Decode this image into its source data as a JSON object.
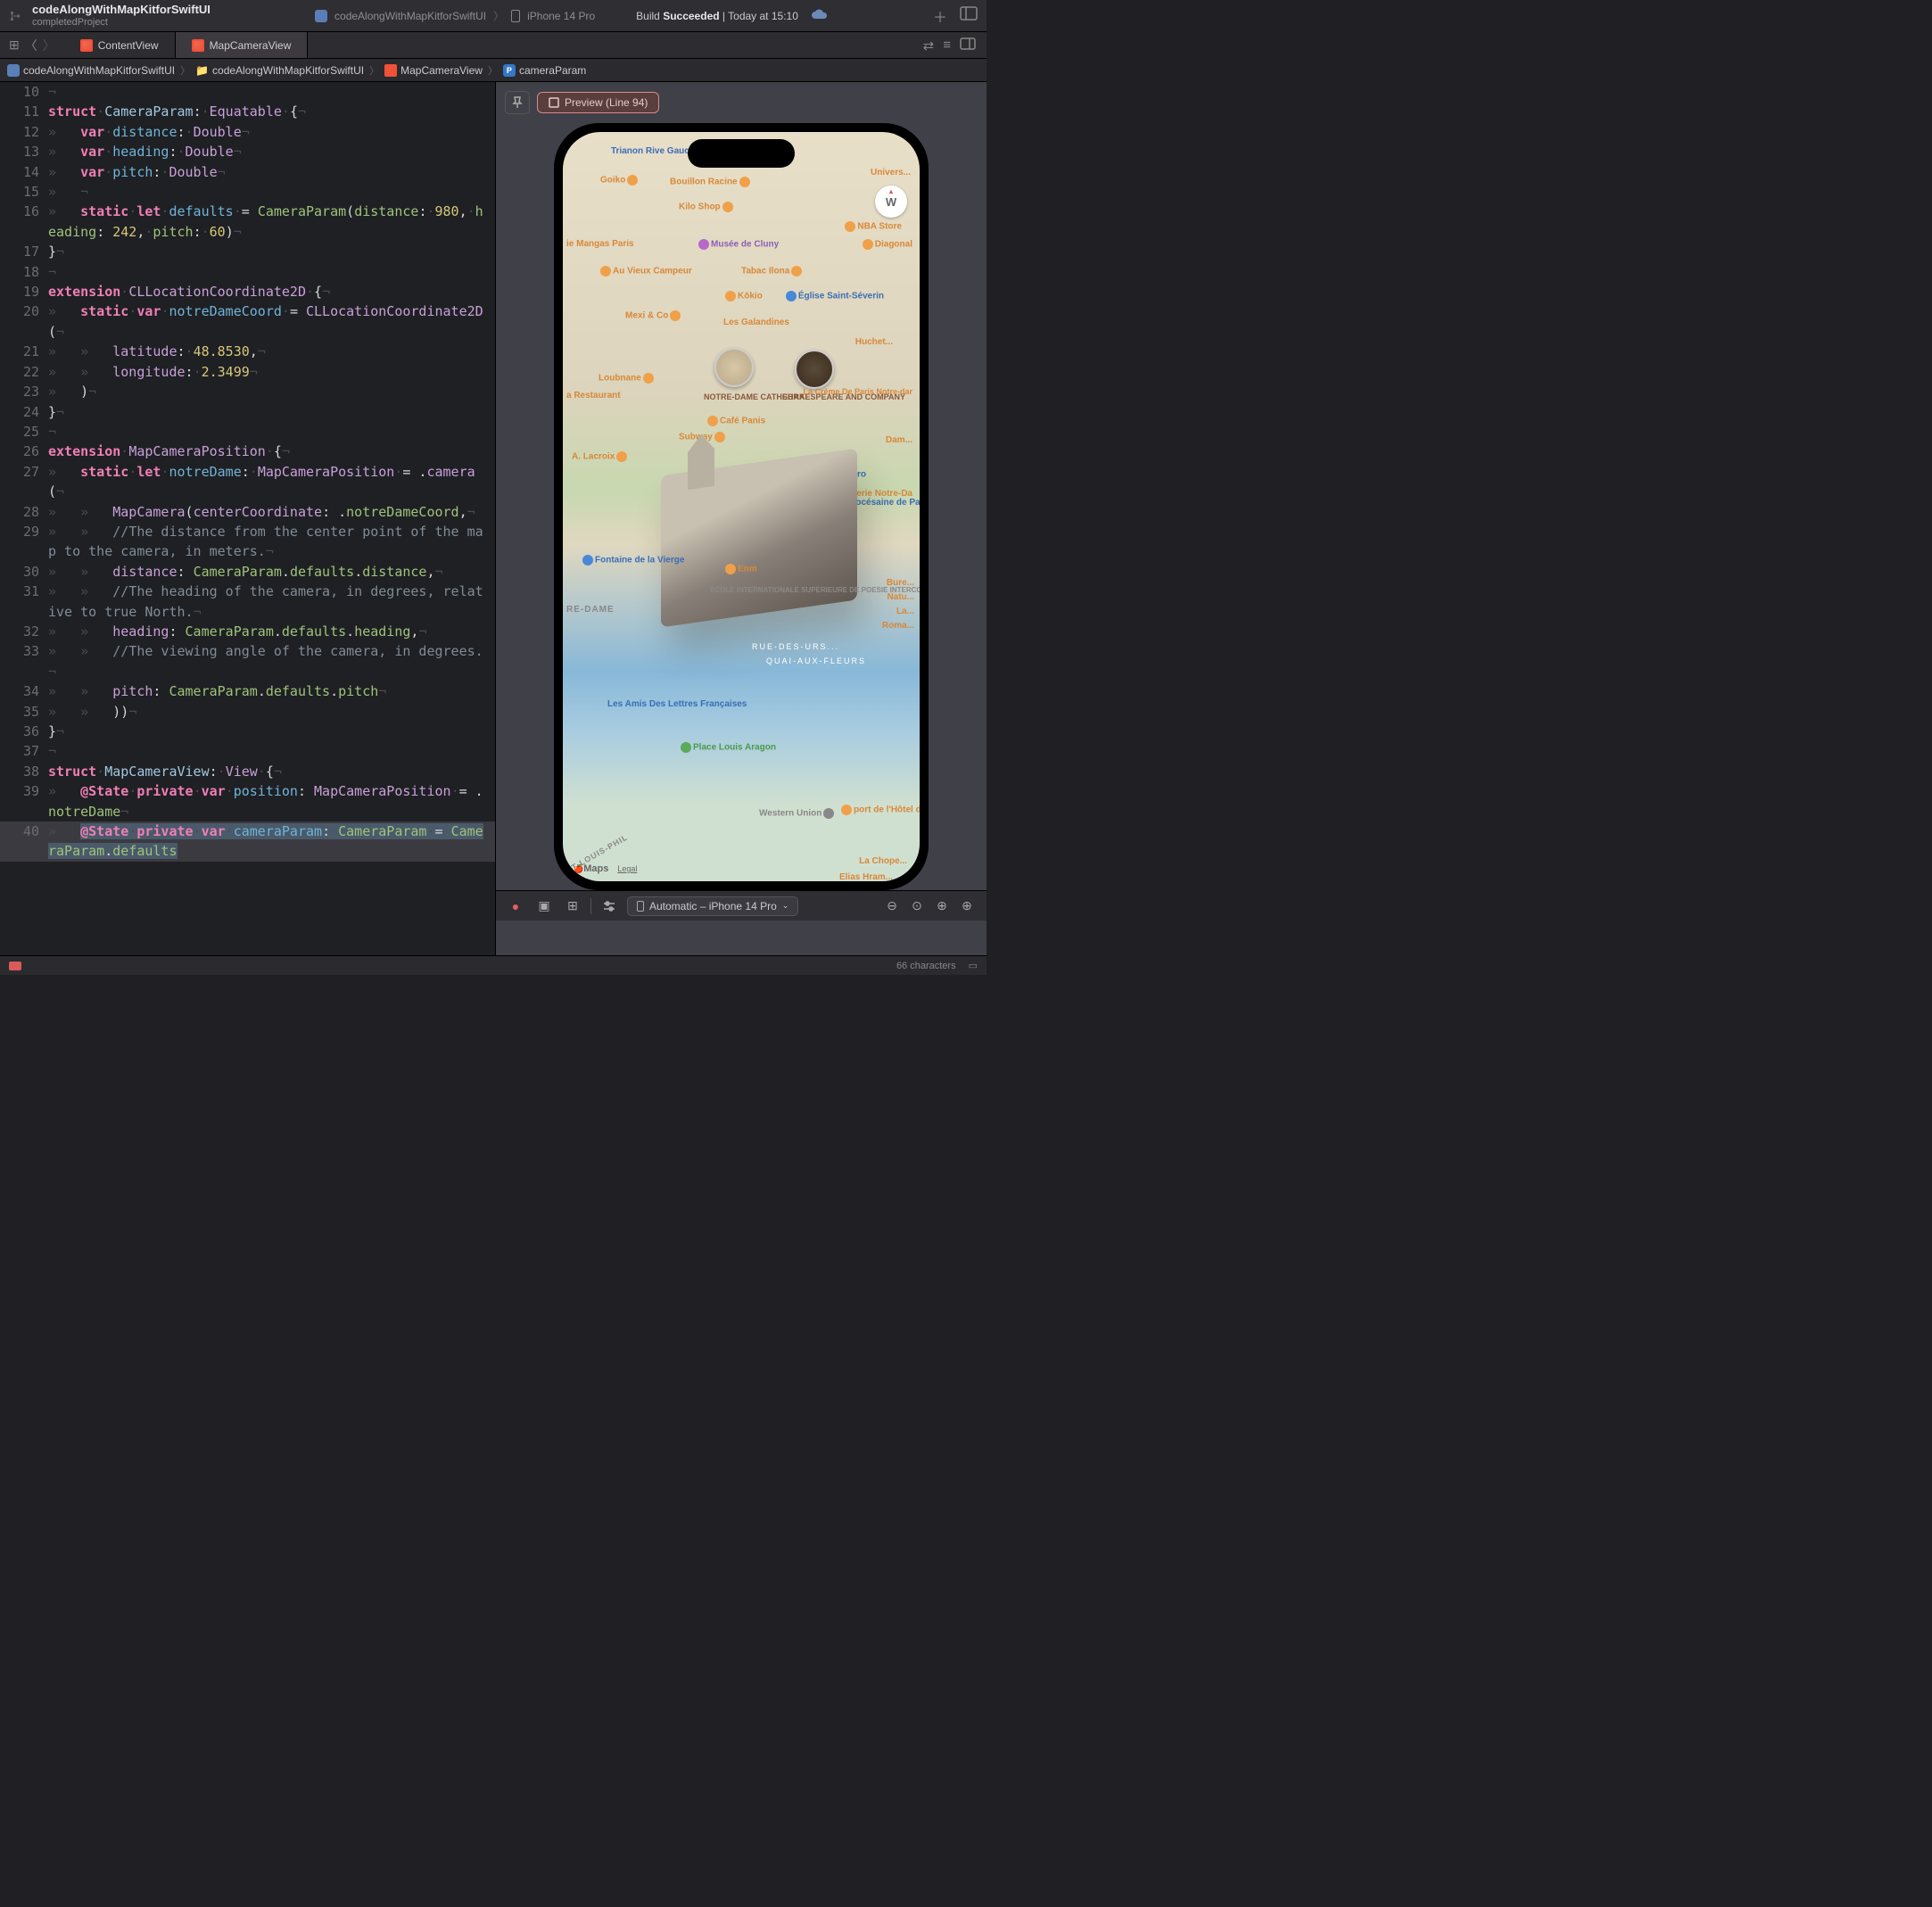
{
  "titlebar": {
    "project": "codeAlongWithMapKitforSwiftUI",
    "subtitle": "completedProject",
    "scheme": "codeAlongWithMapKitforSwiftUI",
    "device": "iPhone 14 Pro",
    "build_prefix": "Build",
    "build_status": "Succeeded",
    "build_time": "Today at 15:10"
  },
  "tabs": {
    "tab1": "ContentView",
    "tab2": "MapCameraView"
  },
  "jumpbar": {
    "project": "codeAlongWithMapKitforSwiftUI",
    "folder": "codeAlongWithMapKitforSwiftUI",
    "file": "MapCameraView",
    "symbol": "cameraParam"
  },
  "lines": {
    "l10": "10",
    "l11": "11",
    "l12": "12",
    "l13": "13",
    "l14": "14",
    "l15": "15",
    "l16": "16",
    "l17": "17",
    "l18": "18",
    "l19": "19",
    "l20": "20",
    "l21": "21",
    "l22": "22",
    "l23": "23",
    "l24": "24",
    "l25": "25",
    "l26": "26",
    "l27": "27",
    "l28": "28",
    "l29": "29",
    "l30": "30",
    "l31": "31",
    "l32": "32",
    "l33": "33",
    "l34": "34",
    "l35": "35",
    "l36": "36",
    "l37": "37",
    "l38": "38",
    "l39": "39",
    "l40": "40"
  },
  "code": {
    "struct": "struct",
    "var": "var",
    "static": "static",
    "let": "let",
    "extension": "extension",
    "private": "private",
    "CameraParam": "CameraParam",
    "Equatable": "Equatable",
    "Double": "Double",
    "distance": "distance",
    "heading": "heading",
    "pitch": "pitch",
    "defaults": "defaults",
    "d980": "980",
    "d242": "242",
    "d60": "60",
    "CLLocationCoordinate2D": "CLLocationCoordinate2D",
    "notreDameCoord": "notreDameCoord",
    "latitude": "latitude",
    "longitude": "longitude",
    "lat": "48.8530",
    "lon": "2.3499",
    "MapCameraPosition": "MapCameraPosition",
    "notreDame": "notreDame",
    "camera": "camera",
    "MapCamera": "MapCamera",
    "centerCoordinate": "centerCoordinate",
    "c1": "//The distance from the center point of the map to the camera, in meters.",
    "c2": "//The heading of the camera, in degrees, relative to true North.",
    "c3": "//The viewing angle of the camera, in degrees.",
    "MapCameraView": "MapCameraView",
    "View": "View",
    "State": "@State",
    "position": "position",
    "cameraParam": "cameraParam"
  },
  "preview": {
    "pill": "Preview (Line 94)",
    "compass": "W",
    "device_selector": "Automatic – iPhone 14 Pro",
    "maps": "Maps",
    "legal": "Legal",
    "pois": {
      "trianon": "Trianon Rive Gauche",
      "goiko": "Goiko",
      "bouillon": "Bouillon Racine",
      "kilo": "Kilo Shop",
      "univers": "Univers...",
      "mangas": "ie Mangas Paris",
      "cluny": "Musée de Cluny",
      "nba": "NBA Store",
      "diagonal": "Diagonal",
      "vieux": "Au Vieux Campeur",
      "ilona": "Tabac Ilona",
      "kokio": "Kōkio",
      "eglise": "Église Saint-Séverin",
      "mexi": "Mexi & Co",
      "galandines": "Les Galandines",
      "huchet": "Huchet...",
      "notredame": "NOTRE-DAME CATHEDRAL",
      "shakespeare": "SHAKESPEARE AND COMPANY",
      "restaurant": "a Restaurant",
      "loubnane": "Loubnane",
      "panis": "Café Panis",
      "creme": "La Crème De Paris Notre-dar",
      "subway": "Subway",
      "lacroix": "A. Lacroix",
      "dam": "Dam...",
      "pointzero": "Point Zéro",
      "assoc": "Association diocésaine de Paris",
      "galerie": "Galerie Notre-Da",
      "fontaine": "Fontaine de la Vierge",
      "enm": "Enm",
      "ecole": "ECOLE INTERNATIONALE SUPERIEURE DE POESIE INTERCONTEMPORAINE EISPI",
      "bure": "Bure...",
      "natu": "Natu...",
      "la": "La...",
      "roma": "Roma...",
      "quai": "QUAI-AUX-FLEURS",
      "ruedes": "RUE-DES-URS...",
      "amis": "Les Amis Des Lettres Françaises",
      "louis": "Place Louis Aragon",
      "western": "Western Union",
      "port": "port de l'Hôtel de-Ville",
      "chope": "La Chope...",
      "elias": "Elias Hram...",
      "notredame_district": "RE-DAME",
      "stlouis": "NT-LOUIS-PHIL"
    }
  },
  "status": {
    "chars": "66 characters"
  }
}
